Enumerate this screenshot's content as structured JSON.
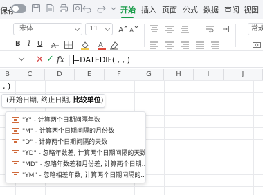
{
  "topbar": {
    "save_label": "保存",
    "tabs": [
      "开始",
      "插入",
      "页面",
      "公式",
      "数据",
      "审阅",
      "视图"
    ],
    "active_tab": "开始",
    "accent_color": "#1a9c4a"
  },
  "ribbon": {
    "font_name": "宋体",
    "font_size": "11",
    "right_label": "常规"
  },
  "formula_bar": {
    "formula": "=DATEDIF( , , )"
  },
  "columns": [
    "B",
    "C",
    "D",
    "E",
    "F",
    "G",
    "H",
    "I",
    "J"
  ],
  "cell_text": ", )",
  "tooltip": {
    "prefix": "(开始日期, 终止日期, ",
    "bold": "比较单位",
    "suffix": ")"
  },
  "autocomplete": {
    "items": [
      "\"Y\" - 计算两个日期间隔年数",
      "\"M\" - 计算两个日期间隔的月份数",
      "\"D\" - 计算两个日期间隔的天数",
      "\"YD\" - 忽略年数差, 计算两个日期间隔的天数",
      "\"MD\" - 忽略年数差和月份差, 计算两个日期...",
      "\"YM\" - 忽略相差年数, 计算两个日期间隔的..."
    ]
  },
  "icons": [
    "toggle",
    "save-icon",
    "file-export-icon",
    "print-icon",
    "preview-icon",
    "undo-icon",
    "redo-icon",
    "more-icon",
    "cancel-icon",
    "confirm-icon",
    "fx-icon",
    "function-list-icon"
  ]
}
